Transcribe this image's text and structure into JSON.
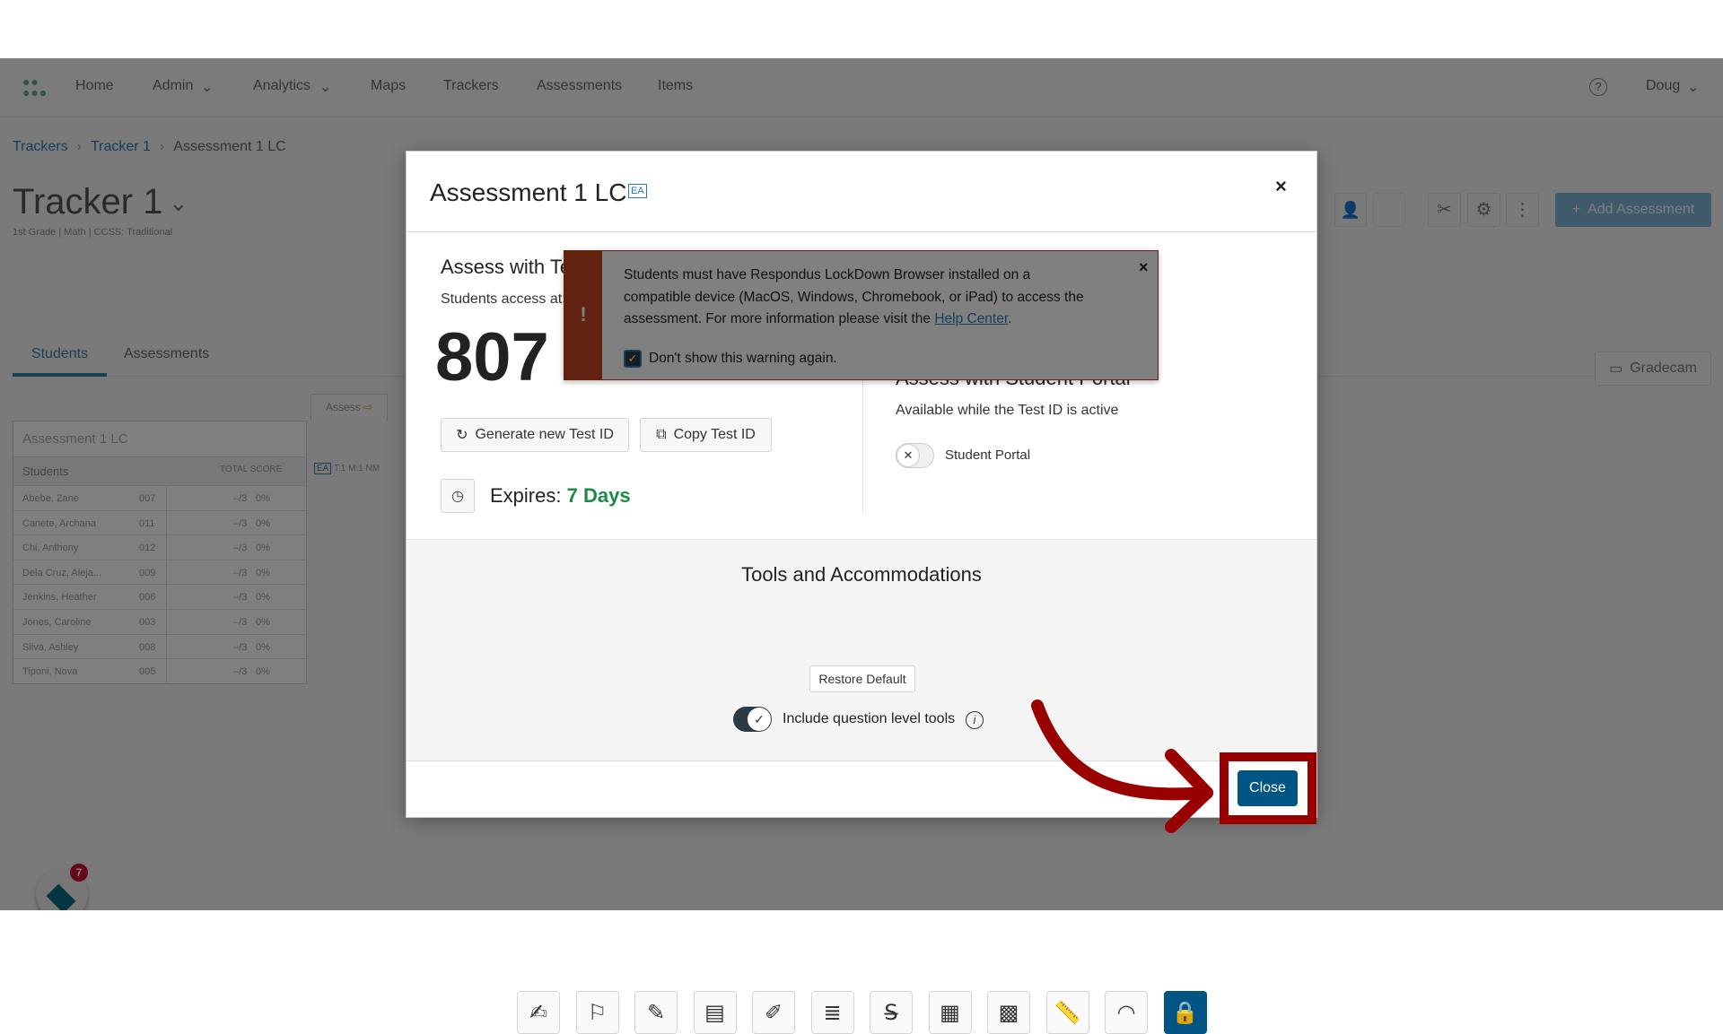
{
  "nav": {
    "items": [
      "Home",
      "Admin",
      "Analytics",
      "Maps",
      "Trackers",
      "Assessments",
      "Items"
    ],
    "user": "Doug"
  },
  "breadcrumb": [
    "Trackers",
    "Tracker 1",
    "Assessment 1 LC"
  ],
  "tracker": {
    "title": "Tracker 1",
    "subtitle": "1st Grade | Math | CCSS: Traditional",
    "tabs": [
      "Students",
      "Assessments"
    ],
    "add_assessment": "Add Assessment",
    "gradecam": "Gradecam",
    "assess": "Assess"
  },
  "table": {
    "title": "Assessment 1 LC",
    "col_students": "Students",
    "col_total": "TOTAL SCORE",
    "col_ea": "EA",
    "col_extra": "T:1  M:1  NM",
    "rows": [
      [
        "Abebe, Zane",
        "007",
        "–/3",
        "0%"
      ],
      [
        "Canete, Archana",
        "011",
        "–/3",
        "0%"
      ],
      [
        "Chi, Anthony",
        "012",
        "–/3",
        "0%"
      ],
      [
        "Dela Cruz, Aleja...",
        "009",
        "–/3",
        "0%"
      ],
      [
        "Jenkins, Heather",
        "006",
        "–/3",
        "0%"
      ],
      [
        "Jones, Caroline",
        "003",
        "–/3",
        "0%"
      ],
      [
        "Silva, Ashley",
        "008",
        "–/3",
        "0%"
      ],
      [
        "Tiponi, Nova",
        "005",
        "–/3",
        "0%"
      ]
    ]
  },
  "modal": {
    "title": "Assessment 1 LC",
    "badge": "EA",
    "assess_test_heading": "Assess with Te",
    "students_access": "Students access at:",
    "test_id": "807",
    "generate": "Generate new Test ID",
    "copy": "Copy Test ID",
    "expires_label": "Expires:",
    "expires_value": "7 Days",
    "portal_heading": "Assess with Student Portal",
    "portal_sub": "Available while the Test ID is active",
    "portal_toggle": "Student Portal",
    "portal_enabled": false,
    "tools_heading": "Tools and Accommodations",
    "tools": [
      {
        "icon": "notepad-icon",
        "g": "✍"
      },
      {
        "icon": "flag-icon",
        "g": "⚐"
      },
      {
        "icon": "highlighter-icon",
        "g": "✎"
      },
      {
        "icon": "line-reader-icon",
        "g": "▤"
      },
      {
        "icon": "clipboard-icon",
        "g": "✐"
      },
      {
        "icon": "sticky-note-icon",
        "g": "≣"
      },
      {
        "icon": "strikethrough-icon",
        "g": "S̶"
      },
      {
        "icon": "calculator-icon",
        "g": "▦"
      },
      {
        "icon": "scientific-calculator-icon",
        "g": "▩"
      },
      {
        "icon": "ruler-icon",
        "g": "📏"
      },
      {
        "icon": "protractor-icon",
        "g": "◠"
      },
      {
        "icon": "lock-icon",
        "g": "🔒",
        "active": true
      }
    ],
    "restore": "Restore Default",
    "include_tools": "Include question level tools",
    "include_tools_enabled": true,
    "close": "Close"
  },
  "alert": {
    "line1": "Students must have Respondus LockDown Browser installed on a",
    "line2": "compatible device (MacOS, Windows, Chromebook, or iPad) to access the",
    "line3": "assessment. For more information please visit the ",
    "link": "Help Center",
    "dont_show": "Don't show this warning again.",
    "checked": true
  },
  "colors": {
    "accent": "#005585",
    "highlight": "#990000",
    "alert": "#c2451e",
    "green": "#1f8a45"
  }
}
